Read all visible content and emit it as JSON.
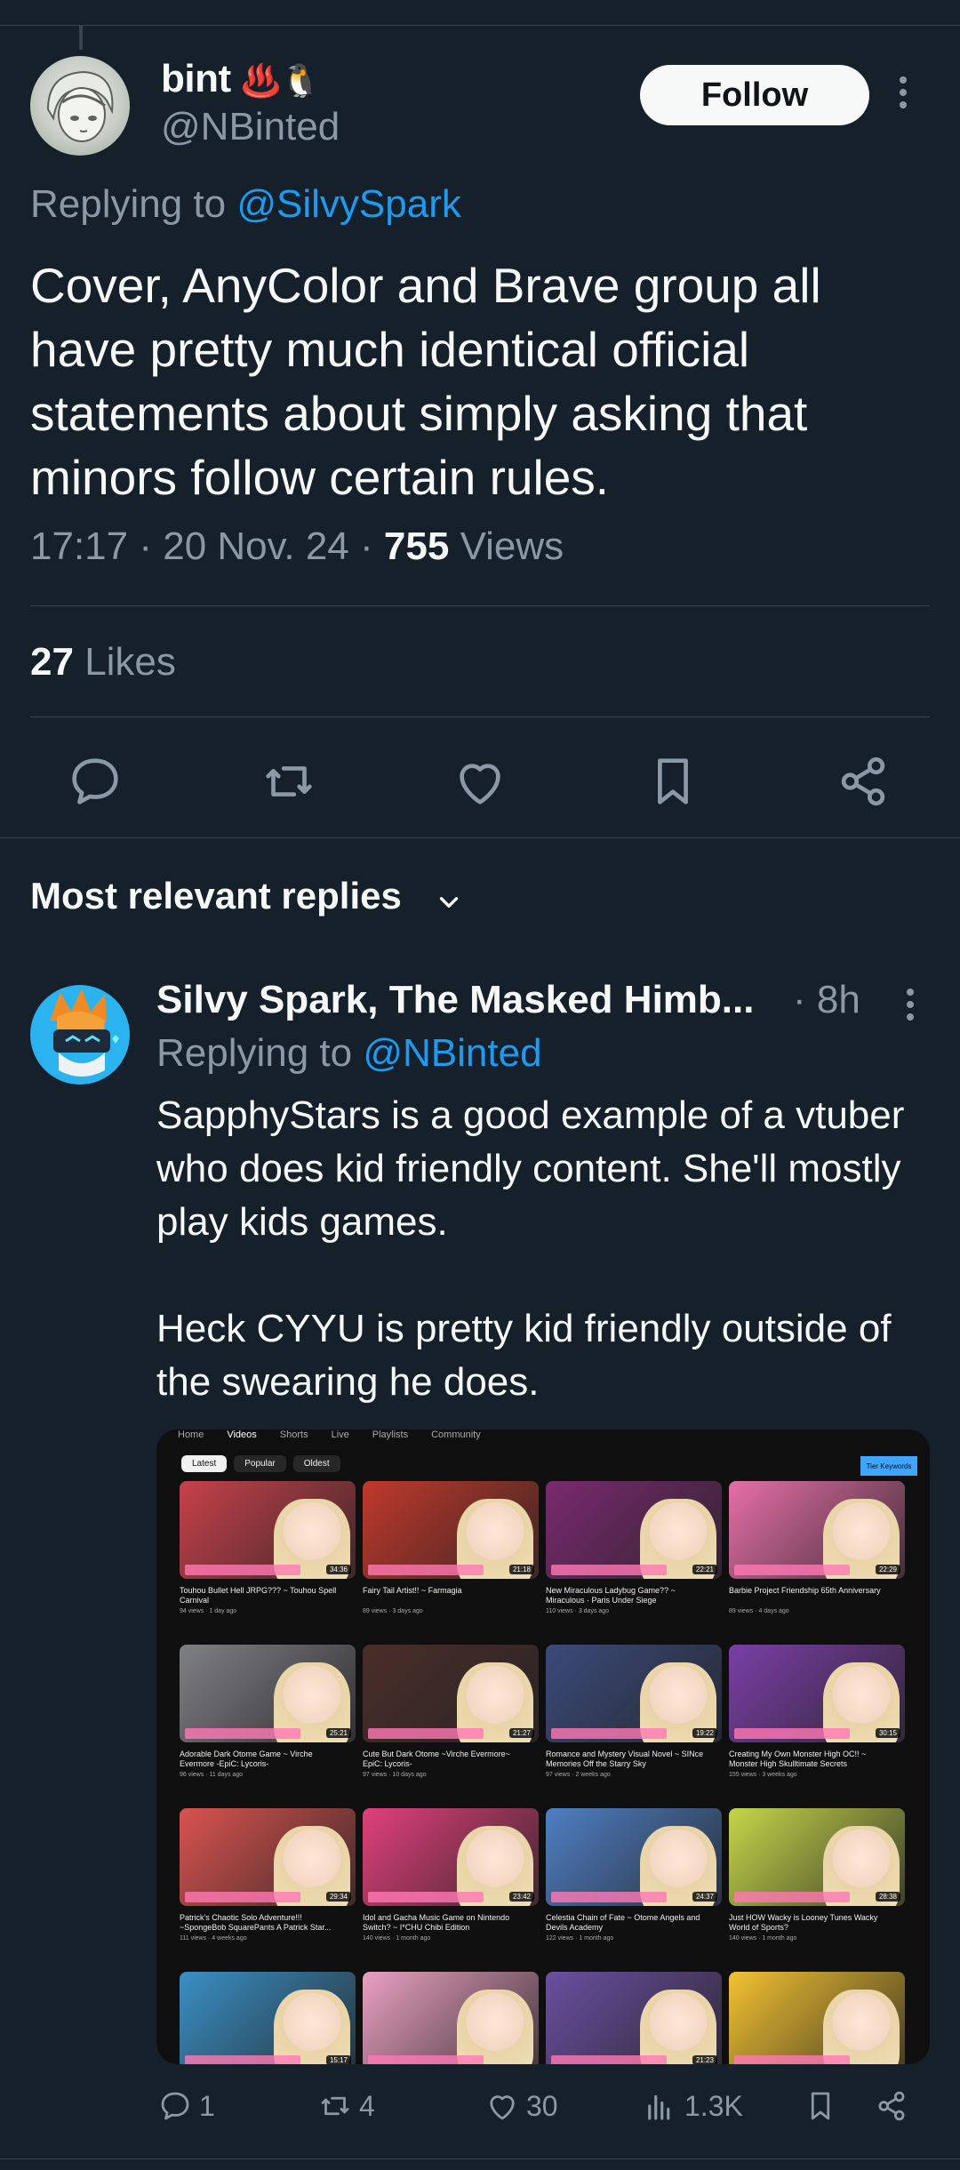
{
  "main_tweet": {
    "display_name": "bint",
    "name_emoji": "♨️🐧",
    "handle": "@NBinted",
    "follow_label": "Follow",
    "replying_prefix": "Replying to ",
    "replying_to": "@SilvySpark",
    "text": "Cover, AnyColor and Brave group all have pretty much identical official statements about simply asking that minors follow certain rules.",
    "time": "17:17",
    "date": "20 Nov. 24",
    "views_count": "755",
    "views_label": "Views",
    "likes_count": "27",
    "likes_label": "Likes",
    "actions": [
      "reply-icon",
      "retweet-icon",
      "like-icon",
      "bookmark-icon",
      "share-icon"
    ]
  },
  "replies_section": {
    "title": "Most relevant replies"
  },
  "reply": {
    "display_name": "Silvy Spark, The Masked Himb...",
    "time": "· 8h",
    "replying_prefix": "Replying to ",
    "replying_to": "@NBinted",
    "text": "SapphyStars is a good example of a vtuber who does kid friendly content. She'll mostly play kids games.\n\nHeck CYYU is pretty kid friendly outside of the swearing he does.",
    "replies_count": "1",
    "retweets_count": "4",
    "likes_count": "30",
    "views_count": "1.3K"
  },
  "embedded_screenshot": {
    "tabs": [
      "Home",
      "Videos",
      "Shorts",
      "Live",
      "Playlists",
      "Community"
    ],
    "chips": [
      "Latest",
      "Popular",
      "Oldest"
    ],
    "blue_badge": "Tier Keywords",
    "videos": [
      {
        "title": "Touhou Bullet Hell JRPG??? ~ Touhou Spell Carnival",
        "meta": "94 views · 1 day ago",
        "duration": "34:36",
        "color": "#c8414b"
      },
      {
        "title": "Fairy Tail Artist!! ~ Farmagia",
        "meta": "89 views · 3 days ago",
        "duration": "21:18",
        "color": "#c0392b"
      },
      {
        "title": "New Miraculous Ladybug Game?? ~ Miraculous · Paris Under Siege",
        "meta": "110 views · 3 days ago",
        "duration": "22:21",
        "color": "#7a2a6f"
      },
      {
        "title": "Barbie Project Friendship 65th Anniversary",
        "meta": "89 views · 4 days ago",
        "duration": "22:29",
        "color": "#e66fa8"
      },
      {
        "title": "Adorable Dark Otome Game ~ Virche Evermore -EpiC: Lycoris-",
        "meta": "96 views · 11 days ago",
        "duration": "25:21",
        "color": "#7f7f86"
      },
      {
        "title": "Cute But Dark Otome ~Virche Evermore~ EpiC: Lycoris-",
        "meta": "97 views · 10 days ago",
        "duration": "21:27",
        "color": "#4a2e2a"
      },
      {
        "title": "Romance and Mystery Visual Novel ~ SINce Memories Off the Starry Sky",
        "meta": "97 views · 2 weeks ago",
        "duration": "19:22",
        "color": "#3b4a7a"
      },
      {
        "title": "Creating My Own Monster High OC!! ~ Monster High Skulltimate Secrets",
        "meta": "155 views · 3 weeks ago",
        "duration": "30:15",
        "color": "#7a3fa6"
      },
      {
        "title": "Patrick's Chaotic Solo Adventure!!! ~SpongeBob SquarePants A Patrick Star...",
        "meta": "111 views · 4 weeks ago",
        "duration": "29:34",
        "color": "#d9534f"
      },
      {
        "title": "Idol and Gacha Music Game on Nintendo Switch? ~ I*CHU Chibi Edition",
        "meta": "140 views · 1 month ago",
        "duration": "23:42",
        "color": "#e0407a"
      },
      {
        "title": "Celestia Chain of Fate ~ Otome Angels and Devils Academy",
        "meta": "122 views · 1 month ago",
        "duration": "24:37",
        "color": "#4f7fc4"
      },
      {
        "title": "Just HOW Wacky is Looney Tunes Wacky World of Sports?",
        "meta": "140 views · 1 month ago",
        "duration": "28:38",
        "color": "#c6d64a"
      },
      {
        "title": "",
        "meta": "",
        "duration": "15:17",
        "color": "#3a8fc4"
      },
      {
        "title": "",
        "meta": "",
        "duration": "",
        "color": "#e9a0c0"
      },
      {
        "title": "",
        "meta": "",
        "duration": "21:23",
        "color": "#6a4fa0"
      },
      {
        "title": "",
        "meta": "",
        "duration": "",
        "color": "#f2c230"
      }
    ]
  },
  "colors": {
    "background": "#15202b",
    "divider": "#38444d",
    "secondary_text": "#8b98a5",
    "link": "#1d9bf0"
  }
}
